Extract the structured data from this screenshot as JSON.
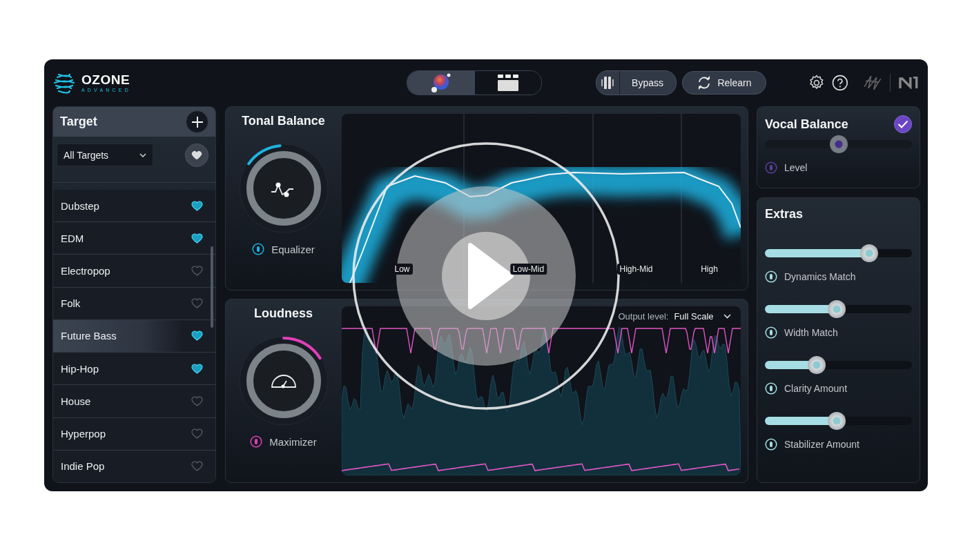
{
  "app": {
    "logo": "OZONE",
    "edition": "ADVANCED"
  },
  "view_switch": [
    {
      "kind": "assistant",
      "selected": true
    },
    {
      "kind": "modules",
      "selected": false
    }
  ],
  "toolbar": {
    "bypass": "Bypass",
    "relearn": "Relearn"
  },
  "target": {
    "title": "Target",
    "filter": "All Targets",
    "items": [
      {
        "label": "Dubstep",
        "favorite": true,
        "selected": false
      },
      {
        "label": "EDM",
        "favorite": true,
        "selected": false
      },
      {
        "label": "Electropop",
        "favorite": false,
        "selected": false
      },
      {
        "label": "Folk",
        "favorite": false,
        "selected": false
      },
      {
        "label": "Future Bass",
        "favorite": true,
        "selected": true
      },
      {
        "label": "Hip-Hop",
        "favorite": true,
        "selected": false
      },
      {
        "label": "House",
        "favorite": false,
        "selected": false
      },
      {
        "label": "Hyperpop",
        "favorite": false,
        "selected": false
      },
      {
        "label": "Indie Pop",
        "favorite": false,
        "selected": false
      }
    ]
  },
  "tonal_balance": {
    "title": "Tonal Balance",
    "module": "Equalizer",
    "bands": [
      "Low",
      "Low-Mid",
      "High-Mid",
      "High"
    ]
  },
  "loudness": {
    "title": "Loudness",
    "module": "Maximizer",
    "output_label": "Output level:",
    "output_value": "Full Scale"
  },
  "vocal_balance": {
    "title": "Vocal Balance",
    "enabled": true,
    "level": 0.5,
    "label": "Level"
  },
  "extras": {
    "title": "Extras",
    "sliders": [
      {
        "label": "Dynamics Match",
        "level": 0.71
      },
      {
        "label": "Width Match",
        "level": 0.49
      },
      {
        "label": "Clarity Amount",
        "level": 0.35
      },
      {
        "label": "Stabilizer Amount",
        "level": 0.49
      }
    ]
  }
}
